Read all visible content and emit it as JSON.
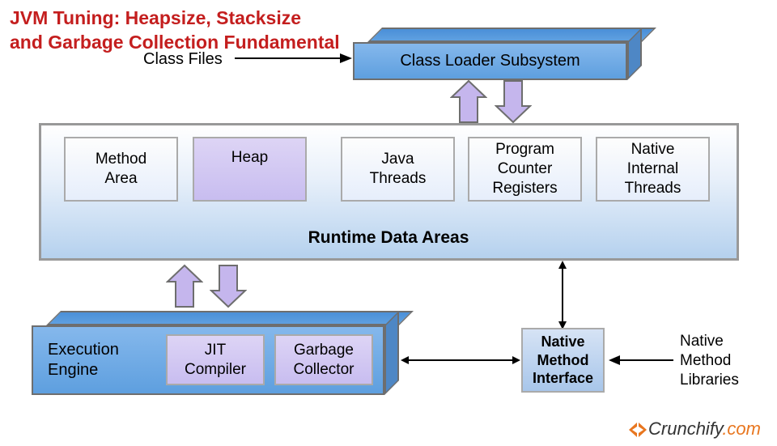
{
  "title_line1": "JVM Tuning: Heapsize, Stacksize",
  "title_line2": "and Garbage Collection Fundamental",
  "class_files_label": "Class Files",
  "class_loader_label": "Class Loader Subsystem",
  "runtime_title": "Runtime Data Areas",
  "runtime_boxes": {
    "method_area": "Method\nArea",
    "heap": "Heap",
    "java_threads": "Java\nThreads",
    "pc_registers": "Program\nCounter\nRegisters",
    "native_threads": "Native\nInternal\nThreads"
  },
  "execution_engine_label": "Execution\nEngine",
  "jit_label": "JIT\nCompiler",
  "gc_label": "Garbage\nCollector",
  "nmi_label": "Native\nMethod\nInterface",
  "nml_label": "Native\nMethod\nLibraries",
  "logo_text1": "Crunchify",
  "logo_text2": ".com"
}
